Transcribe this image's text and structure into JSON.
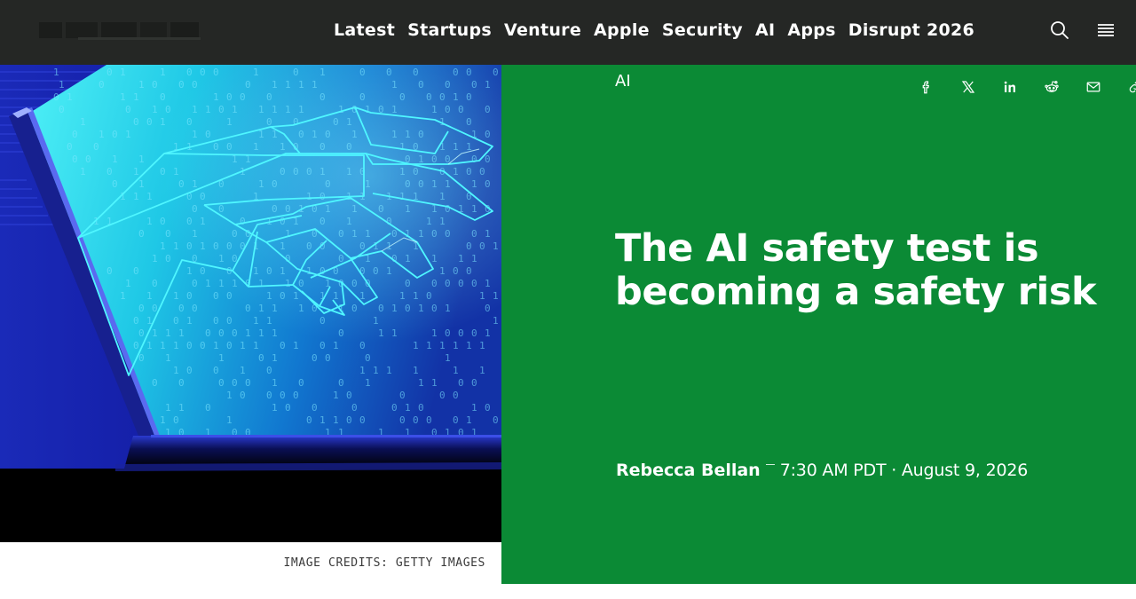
{
  "header": {
    "logo_text": "TechCrunch",
    "nav": [
      "Latest",
      "Startups",
      "Venture",
      "Apple",
      "Security",
      "AI",
      "Apps",
      "Disrupt 2026"
    ],
    "search_icon": "search-icon",
    "menu_icon": "hamburger-menu-icon"
  },
  "hero": {
    "image_credits": "IMAGE CREDITS: GETTY IMAGES",
    "binary_digits": [
      "0",
      "1"
    ]
  },
  "article": {
    "category": "AI",
    "headline": "The AI safety test is becoming a safety risk",
    "author": "Rebecca Bellan",
    "timestamp": "7:30 AM PDT · August 9, 2026"
  },
  "share_icons": [
    "facebook-icon",
    "x-icon",
    "linkedin-icon",
    "reddit-icon",
    "email-icon",
    "link-icon"
  ],
  "colors": {
    "header_bg": "#252725",
    "panel_green": "#0b8a35",
    "hero_cyan": "#35e6f2",
    "hero_blue": "#12158a"
  }
}
